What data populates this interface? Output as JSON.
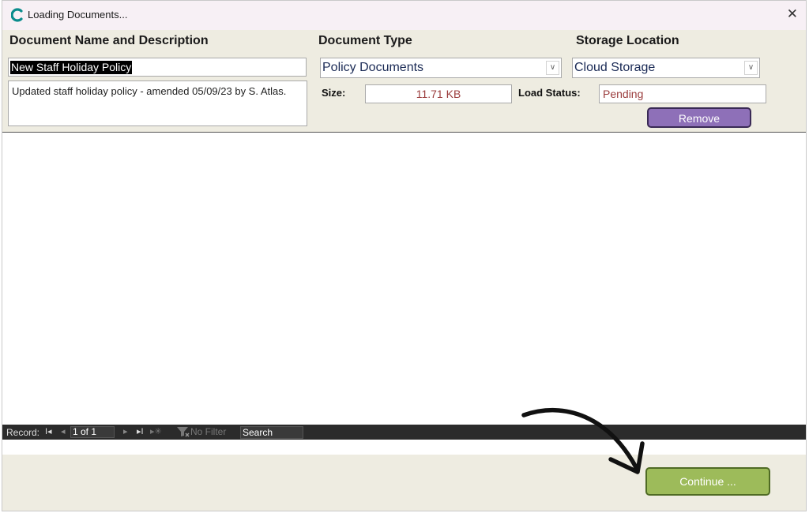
{
  "window": {
    "title": "Loading Documents...",
    "close_glyph": "✕"
  },
  "columns": {
    "name": "Document Name and Description",
    "type": "Document Type",
    "location": "Storage Location"
  },
  "record": {
    "name": "New Staff Holiday Policy",
    "description": "Updated staff holiday policy - amended 05/09/23 by S. Atlas.",
    "document_type": "Policy Documents",
    "storage_location": "Cloud Storage",
    "size_label": "Size:",
    "size_value": "11.71 KB",
    "load_status_label": "Load Status:",
    "load_status_value": "Pending",
    "remove_label": "Remove"
  },
  "navigation": {
    "record_label": "Record:",
    "first": "I◂",
    "prev": "◂",
    "position": "1 of 1",
    "next": "▸",
    "last": "▸I",
    "new": "▸✳",
    "filter_label": "No Filter",
    "search_label": "Search"
  },
  "footer": {
    "continue_label": "Continue ..."
  },
  "colors": {
    "logo": "#0a8c8c",
    "header_bg": "#eeece1",
    "remove_bg": "#8e70b8",
    "continue_bg": "#9dbb5a",
    "status_text": "#9b3d3d"
  }
}
